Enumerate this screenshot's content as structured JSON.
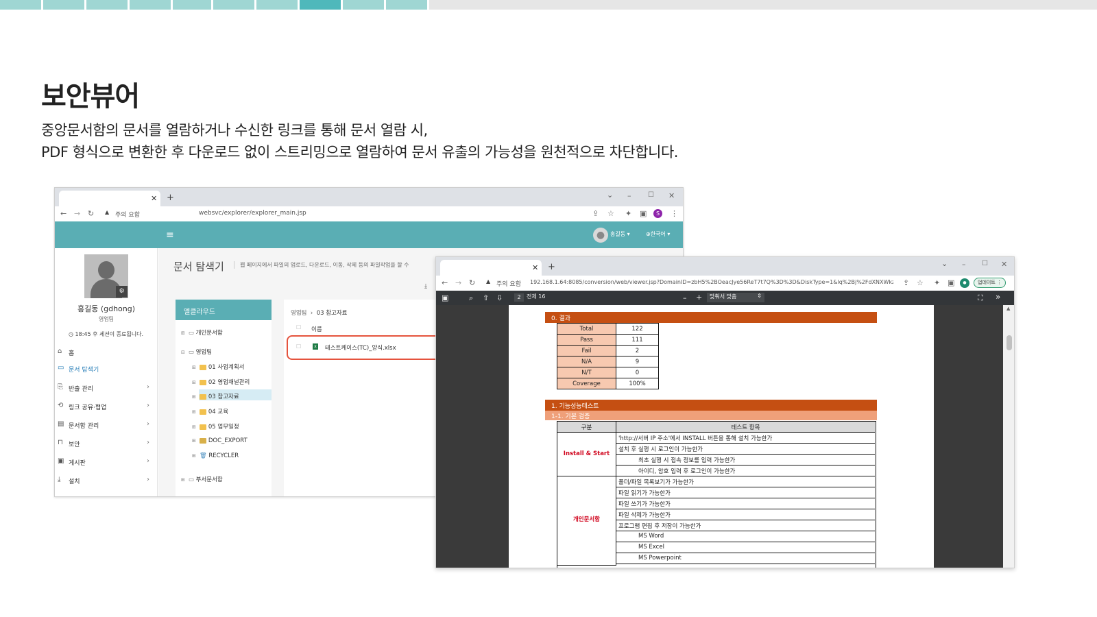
{
  "slide": {
    "title": "보안뷰어",
    "description_line1": "중앙문서함의 문서를 열람하거나 수신한 링크를 통해 문서 열람 시,",
    "description_line2": "PDF 형식으로 변환한 후 다운로드 없이 스트리밍으로 열람하여 문서 유출의 가능성을 원천적으로 차단합니다."
  },
  "colors": {
    "accent": "#5aaeb4",
    "orange": "#c54f12",
    "light_orange": "#efa07a",
    "danger": "#d0021b"
  },
  "explorer_window": {
    "security_label": "주의 요함",
    "url": "websvc/explorer/explorer_main.jsp",
    "profile_letter": "S",
    "user_menu": "홍길동",
    "language_menu": "한국어",
    "user": {
      "name": "홍길동 (gdhong)",
      "dept": "영업팀",
      "session": "18:45 후 세션이 종료됩니다."
    },
    "menu": [
      {
        "label": "홈",
        "icon": "home-icon"
      },
      {
        "label": "문서 탐색기",
        "icon": "folder-icon"
      },
      {
        "label": "반출 관리",
        "icon": "export-icon"
      },
      {
        "label": "링크 공유·협업",
        "icon": "link-icon"
      },
      {
        "label": "문서함 관리",
        "icon": "box-icon"
      },
      {
        "label": "보안",
        "icon": "lock-icon"
      },
      {
        "label": "게시판",
        "icon": "board-icon"
      },
      {
        "label": "설치",
        "icon": "download-icon"
      }
    ],
    "page_title": "문서 탐색기",
    "page_subtitle": "웹 페이지에서 파일의 업로드, 다운로드, 이동, 삭제 등의 파일작업을 할 수",
    "tree_header": "엘클라우드",
    "tree": {
      "personal": "개인문서함",
      "team": "영업팀",
      "folders": [
        "01 사업계획서",
        "02 영업채널관리",
        "03 참고자료",
        "04 교육",
        "05 업무일정",
        "DOC_EXPORT",
        "RECYCLER"
      ],
      "dept": "부서문서함"
    },
    "breadcrumb_root": "영업팀",
    "breadcrumb_current": "03 참고자료",
    "column_name": "이름",
    "file_name": "테스트케이스(TC)_양식.xlsx"
  },
  "viewer_window": {
    "security_label": "주의 요함",
    "url": "192.168.1.64:8085/conversion/web/viewer.jsp?DomainID=zbH5%2BOeacJye56ReT7t7Q%3D%3D&DiskType=1&lq%2Bj%2FdXNXWkzPi...",
    "update_label": "업데이트",
    "page_num": "2",
    "page_total": "전체 16",
    "zoom": "맞춰서 맞춤",
    "section0": "0. 결과",
    "results": [
      {
        "k": "Total",
        "v": "122"
      },
      {
        "k": "Pass",
        "v": "111"
      },
      {
        "k": "Fail",
        "v": "2"
      },
      {
        "k": "N/A",
        "v": "9"
      },
      {
        "k": "N/T",
        "v": "0"
      },
      {
        "k": "Coverage",
        "v": "100%"
      }
    ],
    "section1": "1. 기능성능테스트",
    "section1_1": "1-1. 기본 검증",
    "col_cat": "구분",
    "col_item": "테스트 항목",
    "cat1": "Install & Start",
    "cat2": "개인문서함",
    "items": [
      "'http://서버 IP 주소'에서 INSTALL 버튼을 통해 설치 가능한가",
      "설치 후 실행 시 로그인이 가능한가",
      "    최초 실행 시 접속 정보를 입력 가능한가",
      "    아이디, 암호 입력 후 로그인이 가능한가",
      "폴더/파일 목록보기가 가능한가",
      "파일 읽기가 가능한가",
      "파일 쓰기가 가능한가",
      "파일 삭제가 가능한가",
      "프로그램 편집 후 저장이 가능한가",
      "    MS Word",
      "    MS Excel",
      "    MS Powerpoint"
    ]
  }
}
